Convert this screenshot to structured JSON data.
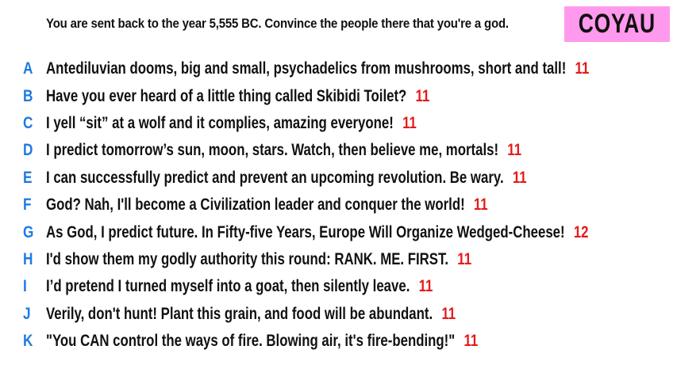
{
  "prompt": "You are sent back to the year 5,555 BC. Convince the people there that you're a god.",
  "badge": {
    "label": "COYAU",
    "color": "#ff99ee"
  },
  "colors": {
    "letter": "#1e7be0",
    "votes": "#e61a1a"
  },
  "answers": [
    {
      "letter": "A",
      "text": "Antediluvian dooms, big and small, psychadelics from mushrooms, short and tall!",
      "votes": "11"
    },
    {
      "letter": "B",
      "text": "Have you ever heard of a little thing called Skibidi Toilet?",
      "votes": "11"
    },
    {
      "letter": "C",
      "text": "I yell “sit” at a wolf and it complies, amazing everyone!",
      "votes": "11"
    },
    {
      "letter": "D",
      "text": "I predict tomorrow’s sun, moon, stars. Watch, then believe me, mortals!",
      "votes": "11"
    },
    {
      "letter": "E",
      "text": "I can successfully predict and prevent an upcoming revolution. Be wary.",
      "votes": "11"
    },
    {
      "letter": "F",
      "text": "God? Nah, I'll become a Civilization leader and conquer the world!",
      "votes": "11"
    },
    {
      "letter": "G",
      "text": "As God, I predict future. In Fifty-five Years, Europe Will Organize Wedged-Cheese!",
      "votes": "12"
    },
    {
      "letter": "H",
      "text": "I'd show them my godly authority this round: RANK. ME. FIRST.",
      "votes": "11"
    },
    {
      "letter": "I",
      "text": "I’d pretend I turned myself into a goat, then silently leave.",
      "votes": "11"
    },
    {
      "letter": "J",
      "text": "Verily, don't hunt! Plant this grain, and food will be abundant.",
      "votes": "11"
    },
    {
      "letter": "K",
      "text": "\"You CAN control the ways of fire. Blowing air, it's fire-bending!\"",
      "votes": "11"
    }
  ]
}
